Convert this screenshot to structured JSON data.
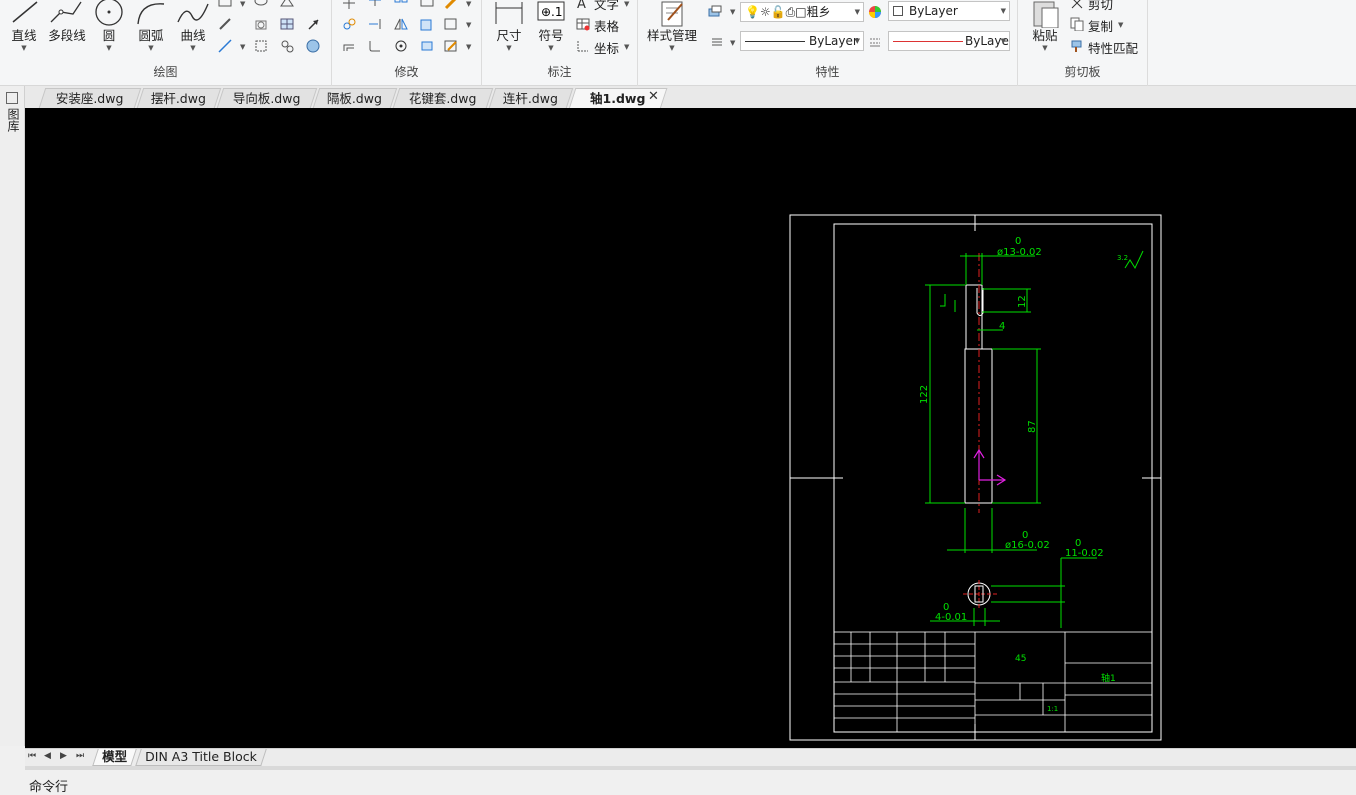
{
  "ribbon": {
    "draw": {
      "title": "绘图",
      "tools": [
        {
          "label": "直线",
          "icon": "line-icon"
        },
        {
          "label": "多段线",
          "icon": "polyline-icon"
        },
        {
          "label": "圆",
          "icon": "circle-icon"
        },
        {
          "label": "圆弧",
          "icon": "arc-icon"
        },
        {
          "label": "曲线",
          "icon": "spline-icon"
        }
      ]
    },
    "modify": {
      "title": "修改"
    },
    "annotate": {
      "title": "标注",
      "dimension": "尺寸",
      "symbol": "符号",
      "text": "文字",
      "table": "表格",
      "coordinate": "坐标"
    },
    "properties": {
      "title": "特性",
      "style_manager": "样式管理",
      "layer_value": "粗乡",
      "color_value": "ByLayer",
      "linetype_value": "ByLayer",
      "lineweight_value": "ByLayer"
    },
    "clipboard": {
      "title": "剪切板",
      "paste": "粘贴",
      "cut": "剪切",
      "copy": "复制",
      "match": "特性匹配"
    }
  },
  "tabs": [
    {
      "label": "安装座.dwg",
      "active": false
    },
    {
      "label": "摆杆.dwg",
      "active": false
    },
    {
      "label": "导向板.dwg",
      "active": false
    },
    {
      "label": "隔板.dwg",
      "active": false
    },
    {
      "label": "花键套.dwg",
      "active": false
    },
    {
      "label": "连杆.dwg",
      "active": false
    },
    {
      "label": "轴1.dwg",
      "active": true
    }
  ],
  "left_strip": {
    "label": "图库"
  },
  "drawing": {
    "dim_top_diameter": "ø13-0.02",
    "dim_top_upper": "0",
    "dim_12": "12",
    "dim_4": "4",
    "dim_122": "122",
    "dim_87": "87",
    "dim_bottom_diameter": "ø16-0.02",
    "dim_bottom_upper": "0",
    "dim_11": "11-0.02",
    "dim_11_upper": "0",
    "dim_4b": "4-0.01",
    "dim_4b_upper": "0",
    "material": "45",
    "part_name": "轴1",
    "scale": "1:1",
    "roughness": "3.2"
  },
  "layout_tabs": [
    {
      "label": "模型",
      "active": true
    },
    {
      "label": "DIN A3 Title Block",
      "active": false
    }
  ],
  "command": {
    "label": "命令行"
  }
}
